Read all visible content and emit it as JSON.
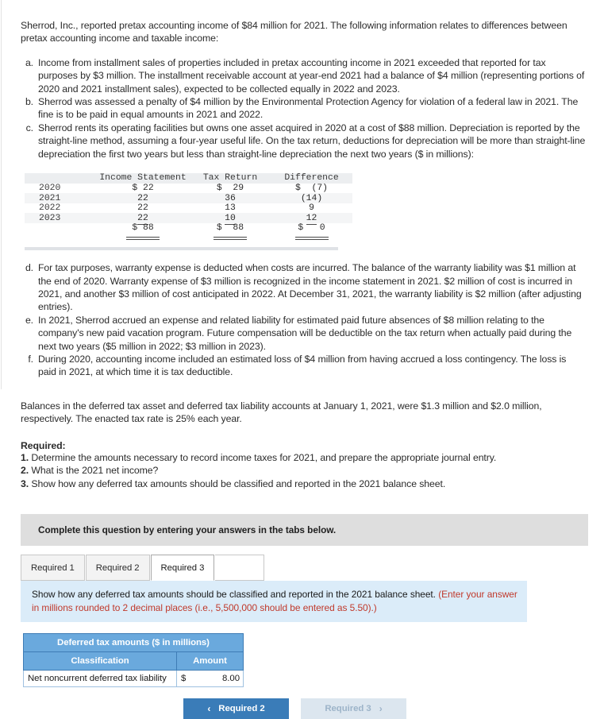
{
  "intro": "Sherrod, Inc., reported pretax accounting income of $84 million for 2021. The following information relates to differences between pretax accounting income and taxable income:",
  "items": [
    {
      "marker": "a.",
      "text": "Income from installment sales of properties included in pretax accounting income in 2021 exceeded that reported for tax purposes by $3 million. The installment receivable account at year-end 2021 had a balance of $4 million (representing portions of 2020 and 2021 installment sales), expected to be collected equally in 2022 and 2023."
    },
    {
      "marker": "b.",
      "text": "Sherrod was assessed a penalty of $4 million by the Environmental Protection Agency for violation of a federal law in 2021. The fine is to be paid in equal amounts in 2021 and 2022."
    },
    {
      "marker": "c.",
      "text": "Sherrod rents its operating facilities but owns one asset acquired in 2020 at a cost of $88 million. Depreciation is reported by the straight-line method, assuming a four-year useful life. On the tax return, deductions for depreciation will be more than straight-line depreciation the first two years but less than straight-line depreciation the next two years ($ in millions):"
    }
  ],
  "items_lower": [
    {
      "marker": "d.",
      "text": "For tax purposes, warranty expense is deducted when costs are incurred. The balance of the warranty liability was $1 million at the end of 2020. Warranty expense of $3 million is recognized in the income statement in 2021. $2 million of cost is incurred in 2021, and another $3 million of cost anticipated in 2022. At December 31, 2021, the warranty liability is $2 million (after adjusting entries)."
    },
    {
      "marker": "e.",
      "text": "In 2021, Sherrod accrued an expense and related liability for estimated paid future absences of $8 million relating to the company's new paid vacation program. Future compensation will be deductible on the tax return when actually paid during the next two years ($5 million in 2022; $3 million in 2023)."
    },
    {
      "marker": "f.",
      "text": "During 2020, accounting income included an estimated loss of $4 million from having accrued a loss contingency. The loss is paid in 2021, at which time it is tax deductible."
    }
  ],
  "depreciation_table": {
    "headers": [
      "",
      "Income Statement",
      "Tax Return",
      "Difference"
    ],
    "rows": [
      {
        "year": "2020",
        "income_statement": "$ 22",
        "tax_return": "$  29",
        "difference": "$  (7)"
      },
      {
        "year": "2021",
        "income_statement": "22",
        "tax_return": "36",
        "difference": "(14)"
      },
      {
        "year": "2022",
        "income_statement": "22",
        "tax_return": "13",
        "difference": "9"
      },
      {
        "year": "2023",
        "income_statement": "22",
        "tax_return": "10",
        "difference": "12"
      }
    ],
    "totals": {
      "year": "",
      "income_statement": "$ 88",
      "tax_return": "$  88",
      "difference": "$   0"
    }
  },
  "balances": "Balances in the deferred tax asset and deferred tax liability accounts at January 1, 2021, were $1.3 million and $2.0 million, respectively. The enacted tax rate is 25% each year.",
  "required": {
    "heading": "Required:",
    "lines": [
      {
        "num": "1.",
        "text": "Determine the amounts necessary to record income taxes for 2021, and prepare the appropriate journal entry."
      },
      {
        "num": "2.",
        "text": "What is the 2021 net income?"
      },
      {
        "num": "3.",
        "text": "Show how any deferred tax amounts should be classified and reported in the 2021 balance sheet."
      }
    ]
  },
  "widget": {
    "complete_bar": "Complete this question by entering your answers in the tabs below.",
    "tabs": [
      {
        "label": "Required 1",
        "active": false
      },
      {
        "label": "Required 2",
        "active": false
      },
      {
        "label": "Required 3",
        "active": true
      }
    ],
    "instruction": "Show how any deferred tax amounts should be classified and reported in the 2021 balance sheet.",
    "instruction_hint": "(Enter your answer in millions rounded to 2 decimal places (i.e., 5,500,000 should be entered as 5.50).)",
    "answer_table": {
      "title": "Deferred tax amounts ($ in millions)",
      "col_classification": "Classification",
      "col_amount": "Amount",
      "row_label": "Net noncurrent deferred tax liability",
      "row_currency": "$",
      "row_amount": "8.00"
    },
    "nav": {
      "prev_label": "Required 2",
      "prev_chevron": "‹",
      "next_label": "Required 3",
      "next_chevron": "›"
    }
  },
  "colors": {
    "tab_active": "#ffffff",
    "banner_gray": "#dedede",
    "banner_blue": "#dbecf9",
    "table_header_blue": "#6aa9dd",
    "hint_red": "#c0392b",
    "button_blue": "#3a7cb8",
    "button_disabled": "#dce6ef"
  }
}
